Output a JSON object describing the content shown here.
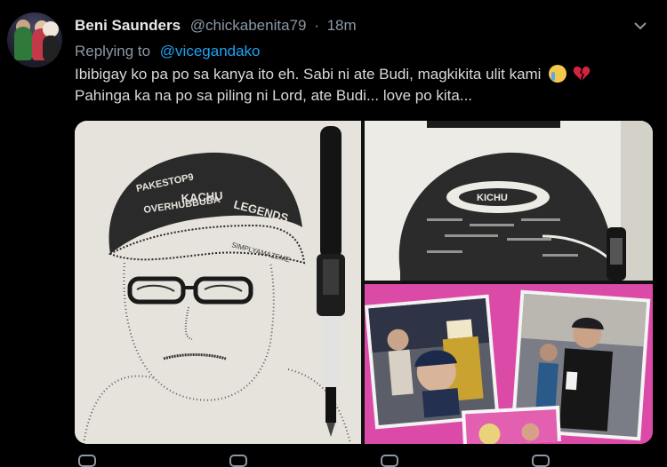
{
  "tweet": {
    "display_name": "Beni Saunders",
    "handle": "@chickabenita79",
    "separator": "·",
    "time": "18m",
    "replying_label": "Replying to",
    "replying_to": "@vicegandako",
    "line1": "Ibibigay ko pa po sa kanya ito eh. Sabi ni ate Budi, magkikita ulit kami",
    "line2": "Pahinga ka na po sa piling ni Lord, ate Budi... love po kita...",
    "emojis": [
      "crying-face-icon",
      "broken-heart-icon"
    ]
  },
  "media": {
    "drawing_words": "PAKESTOP OVERHUBBUBA LEGENDS YAZOUIN SIMPLYAMAZE ME KACHU",
    "cap_word": "KICHU"
  },
  "colors": {
    "background": "#000000",
    "text": "#d9d9d9",
    "muted": "#8b98a5",
    "link": "#1da1f2",
    "accent_pink": "#d93ca2"
  }
}
